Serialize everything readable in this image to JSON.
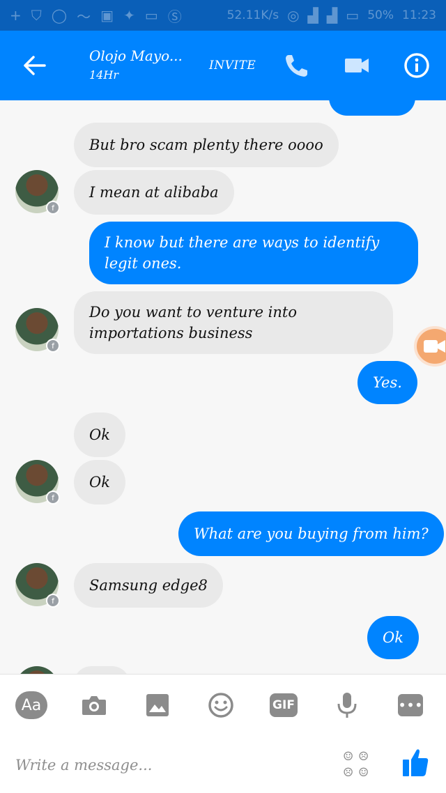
{
  "status_bar": {
    "network_speed": "52.11K/s",
    "battery": "50%",
    "time": "11:23",
    "icons": [
      "add-icon",
      "shield-icon",
      "whatsapp-icon",
      "wave-icon",
      "gallery-icon",
      "twitter-icon",
      "chat-icon",
      "s-icon"
    ]
  },
  "header": {
    "contact_name": "Olojo Mayo...",
    "contact_status": "14Hr",
    "invite_label": "INVITE",
    "color": "#0084ff"
  },
  "messages": [
    {
      "from": "other",
      "text": "But bro scam plenty there oooo"
    },
    {
      "from": "other",
      "text": "I mean at alibaba"
    },
    {
      "from": "me",
      "text": "I know but there are ways to identify legit ones."
    },
    {
      "from": "other",
      "text": "Do you want to venture into importations business"
    },
    {
      "from": "me",
      "text": "Yes."
    },
    {
      "from": "other",
      "text": "Ok"
    },
    {
      "from": "other",
      "text": "Ok"
    },
    {
      "from": "me",
      "text": "What are you buying from him?"
    },
    {
      "from": "other",
      "text": "Samsung edge8"
    },
    {
      "from": "me",
      "text": "Ok"
    }
  ],
  "toolbar": {
    "aa_label": "Aa",
    "gif_label": "GIF",
    "more_label": "•••",
    "input_placeholder": "Write a message..."
  }
}
